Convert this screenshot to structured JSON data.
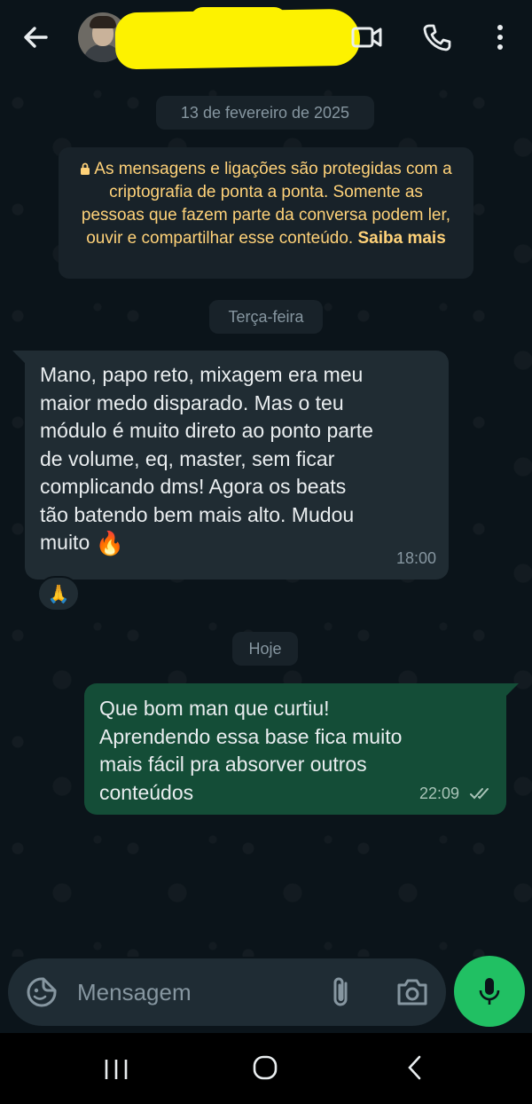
{
  "header": {
    "contact_name": "",
    "icons": [
      "arrow-left-icon",
      "video-call-icon",
      "phone-icon",
      "more-vertical-icon"
    ]
  },
  "chat": {
    "date_separator": "13 de fevereiro de 2025",
    "encryption_notice": {
      "text": "As mensagens e ligações são protegidas com a criptografia de ponta a ponta. Somente as pessoas que fazem parte da conversa podem ler, ouvir e compartilhar esse conteúdo.",
      "link": "Saiba mais"
    },
    "day_separator_1": "Terça-feira",
    "day_separator_2": "Hoje",
    "messages": [
      {
        "direction": "incoming",
        "text": "Mano, papo reto, mixagem era meu\nmaior medo disparado. Mas o teu\nmódulo é muito direto ao ponto parte\nde volume, eq, master, sem ficar\ncomplicando dms! Agora os beats\ntão batendo bem mais alto. Mudou\nmuito ",
        "emoji": "🔥",
        "time": "18:00",
        "reaction": "🙏"
      },
      {
        "direction": "outgoing",
        "text": "Que bom man que curtiu!\nAprendendo essa base fica muito\nmais fácil pra absorver outros\nconteúdos",
        "time": "22:09",
        "status": "read"
      }
    ]
  },
  "composer": {
    "placeholder": "Mensagem"
  },
  "colors": {
    "background": "#0b141a",
    "incoming_bubble": "#202c33",
    "outgoing_bubble": "#144d37",
    "accent_green": "#21c063",
    "notice_text": "#ffd279"
  }
}
